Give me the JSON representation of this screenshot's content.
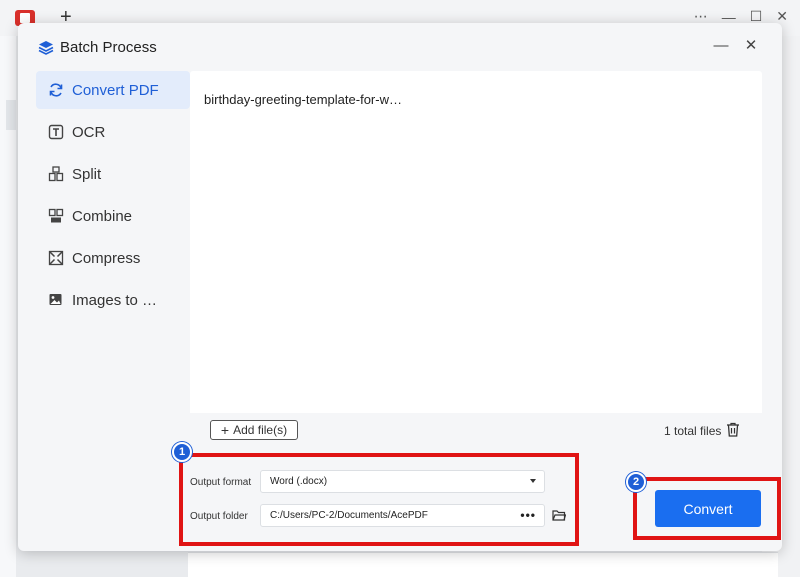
{
  "dialog": {
    "title": "Batch Process",
    "minimize_glyph": "—",
    "close_glyph": "✕"
  },
  "sidebar": {
    "items": [
      {
        "label": "Convert PDF",
        "icon": "refresh-icon",
        "active": true
      },
      {
        "label": "OCR",
        "icon": "ocr-icon",
        "active": false
      },
      {
        "label": "Split",
        "icon": "split-icon",
        "active": false
      },
      {
        "label": "Combine",
        "icon": "combine-icon",
        "active": false
      },
      {
        "label": "Compress",
        "icon": "compress-icon",
        "active": false
      },
      {
        "label": "Images to …",
        "icon": "image-icon",
        "active": false
      }
    ]
  },
  "files": {
    "items": [
      "birthday-greeting-template-for-w…"
    ],
    "add_label": "Add file(s)",
    "total_label": "1 total files"
  },
  "output": {
    "format_label": "Output format",
    "format_value": "Word (.docx)",
    "folder_label": "Output folder",
    "folder_value": "C:/Users/PC-2/Documents/AcePDF",
    "folder_more": "•••"
  },
  "actions": {
    "convert_label": "Convert"
  },
  "annotations": {
    "badge_1": "1",
    "badge_2": "2"
  },
  "colors": {
    "accent": "#1a6ef0",
    "active_text": "#1f5fd6",
    "annotation_red": "#e01414"
  }
}
